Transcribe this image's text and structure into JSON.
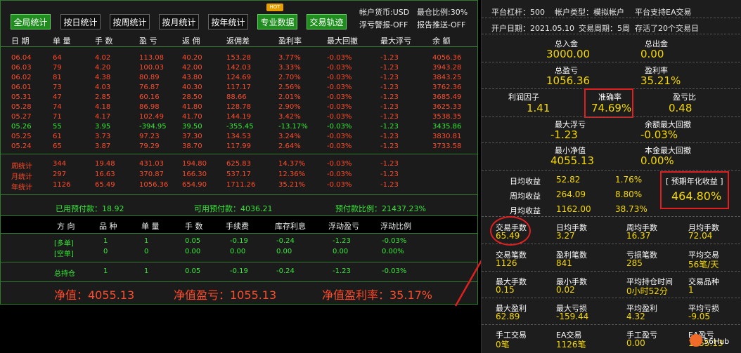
{
  "colors": {
    "green_border": "#2f7a2f",
    "red_text": "#ff4b2b",
    "green_text": "#37e637",
    "yellow_text": "#f5d800",
    "panel_bg": "#1d1d1d",
    "panel_value": "#f5d800"
  },
  "toolbar": {
    "buttons": [
      "全局统计",
      "按日统计",
      "按周统计",
      "按月统计",
      "按年统计",
      "专业数据",
      "交易轨迹"
    ],
    "hot_badge": "HOT",
    "account_currency": "帐户货币:USD",
    "position_ratio": "最仓比例:30%",
    "float_warning": "浮亏警报-OFF",
    "report_push": "报告推送-OFF"
  },
  "table": {
    "headers": [
      "日 期",
      "单 量",
      "手 数",
      "盈 亏",
      "返 佣",
      "返佣差",
      "盈利率",
      "最大回撤",
      "最大浮亏",
      "余 额"
    ],
    "rows": [
      [
        "06.04",
        "64",
        "4.02",
        "113.08",
        "40.20",
        "153.28",
        "3.77%",
        "-0.03%",
        "-1.23",
        "4056.36"
      ],
      [
        "06.03",
        "79",
        "4.20",
        "100.03",
        "42.00",
        "142.03",
        "3.33%",
        "-0.03%",
        "-1.23",
        "3943.28"
      ],
      [
        "06.02",
        "81",
        "4.38",
        "80.89",
        "43.80",
        "124.69",
        "2.70%",
        "-0.03%",
        "-1.23",
        "3843.25"
      ],
      [
        "06.01",
        "73",
        "4.03",
        "76.87",
        "40.30",
        "117.17",
        "2.56%",
        "-0.03%",
        "-1.23",
        "3762.36"
      ],
      [
        "05.31",
        "47",
        "2.85",
        "60.16",
        "28.50",
        "88.66",
        "2.01%",
        "-0.03%",
        "-1.23",
        "3685.49"
      ],
      [
        "05.28",
        "74",
        "4.18",
        "86.98",
        "41.80",
        "128.78",
        "2.90%",
        "-0.03%",
        "-1.23",
        "3625.33"
      ],
      [
        "05.27",
        "71",
        "4.17",
        "102.49",
        "41.70",
        "144.19",
        "3.42%",
        "-0.03%",
        "-1.23",
        "3538.35"
      ],
      [
        "05.26",
        "55",
        "3.95",
        "-394.95",
        "39.50",
        "-355.45",
        "-13.17%",
        "-0.03%",
        "-1.23",
        "3435.86"
      ],
      [
        "05.25",
        "61",
        "3.73",
        "97.23",
        "37.30",
        "134.53",
        "3.24%",
        "-0.03%",
        "-1.23",
        "3830.81"
      ],
      [
        "05.24",
        "65",
        "3.87",
        "79.29",
        "38.70",
        "117.99",
        "2.64%",
        "-0.03%",
        "-1.23",
        "3733.58"
      ]
    ],
    "summary": [
      [
        "周统计",
        "344",
        "19.48",
        "431.03",
        "194.80",
        "625.83",
        "14.37%",
        "-0.03%",
        "-1.23"
      ],
      [
        "月统计",
        "297",
        "16.63",
        "370.87",
        "166.30",
        "537.17",
        "12.36%",
        "-0.03%",
        "-1.23"
      ],
      [
        "年统计",
        "1126",
        "65.49",
        "1056.36",
        "654.90",
        "1711.26",
        "35.21%",
        "-0.03%",
        "-1.23"
      ]
    ],
    "prepay": {
      "used": "已用预付款：18.92",
      "available": "可用预付款：4036.21",
      "ratio": "预付款比例：21437.23%"
    },
    "pos_headers": [
      "方 向",
      "品 种",
      "单 量",
      "手 数",
      "手续费",
      "库存利息",
      "浮动盈亏",
      "浮动比例"
    ],
    "pos_rows": [
      [
        "[多单]",
        "1",
        "1",
        "0.05",
        "-0.19",
        "-0.24",
        "-1.23",
        "-0.03%"
      ],
      [
        "[空单]",
        "0",
        "0",
        "0.00",
        "0.00",
        "0.00",
        "0.00",
        "0.00%"
      ]
    ],
    "total_row": [
      "总持仓",
      "1",
      "1",
      "0.05",
      "-0.19",
      "-0.24",
      "-1.23",
      "-0.03%"
    ],
    "net_value": "净值：4055.13",
    "net_profit": "净值盈亏：1055.13",
    "net_rate": "净值盈利率：35.17%"
  },
  "panel": {
    "line1": [
      "平台杠杆：500",
      "帐户类型：模拟帐户",
      "平台支持EA交易"
    ],
    "line2": [
      "开户日期：2021.05.10",
      "交易周期：5周",
      "存活了20个交易日"
    ],
    "total_in_label": "总入金",
    "total_in": "3000.00",
    "total_out_label": "总出金",
    "total_out": "0.00",
    "total_pl_label": "总盈亏",
    "total_pl": "1056.36",
    "profit_rate_label": "盈利率",
    "profit_rate": "35.21%",
    "profit_factor_label": "利润因子",
    "profit_factor": "1.41",
    "accuracy_label": "准确率",
    "accuracy": "74.69%",
    "pl_ratio_label": "盈亏比",
    "pl_ratio": "0.48",
    "max_float_label": "最大浮亏",
    "max_float": "-1.23",
    "bal_drawdown_label": "余额最大回撤",
    "bal_drawdown": "-0.03%",
    "min_net_label": "最小净值",
    "min_net": "4055.13",
    "principal_drawdown_label": "本金最大回撤",
    "principal_drawdown": "0.00%",
    "daily_label": "日均收益",
    "daily_val": "52.82",
    "daily_pct": "1.76%",
    "weekly_label": "周均收益",
    "weekly_val": "264.09",
    "weekly_pct": "8.80%",
    "monthly_label": "月均收益",
    "monthly_val": "1162.00",
    "monthly_pct": "38.73%",
    "annual_label": "[ 预期年化收益 ]",
    "annual_val": "464.80%",
    "grid1": [
      {
        "label": "交易手数",
        "value": "65.49"
      },
      {
        "label": "日均手数",
        "value": "3.27"
      },
      {
        "label": "周均手数",
        "value": "16.37"
      },
      {
        "label": "月均手数",
        "value": "72.04"
      }
    ],
    "grid2": [
      {
        "label": "交易笔数",
        "value": "1126"
      },
      {
        "label": "盈利笔数",
        "value": "841"
      },
      {
        "label": "亏损笔数",
        "value": "285"
      },
      {
        "label": "平均交易",
        "value": "56笔/天"
      }
    ],
    "grid3": [
      {
        "label": "最大手数",
        "value": "0.15"
      },
      {
        "label": "最小手数",
        "value": "0.02"
      },
      {
        "label": "平均持仓时间",
        "value": "0小时52分"
      },
      {
        "label": "交易品种",
        "value": "1"
      }
    ],
    "grid4": [
      {
        "label": "最大盈利",
        "value": "62.89"
      },
      {
        "label": "最大亏损",
        "value": "-159.44"
      },
      {
        "label": "平均盈利",
        "value": "4.32"
      },
      {
        "label": "平均亏损",
        "value": "-9.05"
      }
    ],
    "grid5": [
      {
        "label": "手工交易",
        "value": "0笔"
      },
      {
        "label": "EA交易",
        "value": "1126笔"
      },
      {
        "label": "手工盈亏",
        "value": "0.00"
      },
      {
        "label": "EA盈亏",
        "value": "1055.13"
      }
    ],
    "watermark": "56Hub"
  }
}
